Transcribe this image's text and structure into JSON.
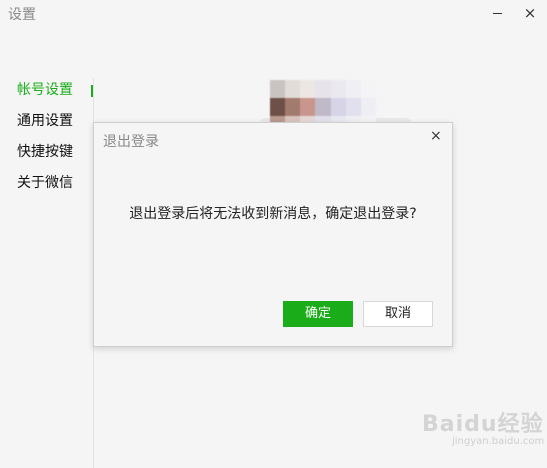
{
  "window": {
    "title": "设置",
    "minimize_icon": "minimize-icon",
    "close_glyph": "×"
  },
  "sidebar": {
    "items": [
      {
        "label": "帐号设置",
        "active": true
      },
      {
        "label": "通用设置",
        "active": false
      },
      {
        "label": "快捷按键",
        "active": false
      },
      {
        "label": "关于微信",
        "active": false
      }
    ]
  },
  "dialog": {
    "title": "退出登录",
    "close_glyph": "×",
    "message": "退出登录后将无法收到新消息，确定退出登录?",
    "ok_label": "确定",
    "cancel_label": "取消"
  },
  "watermark": {
    "text": "Baidu经验",
    "sub": "jingyan.baidu.com"
  },
  "colors": {
    "accent": "#1aad19",
    "background": "#f5f5f5"
  }
}
